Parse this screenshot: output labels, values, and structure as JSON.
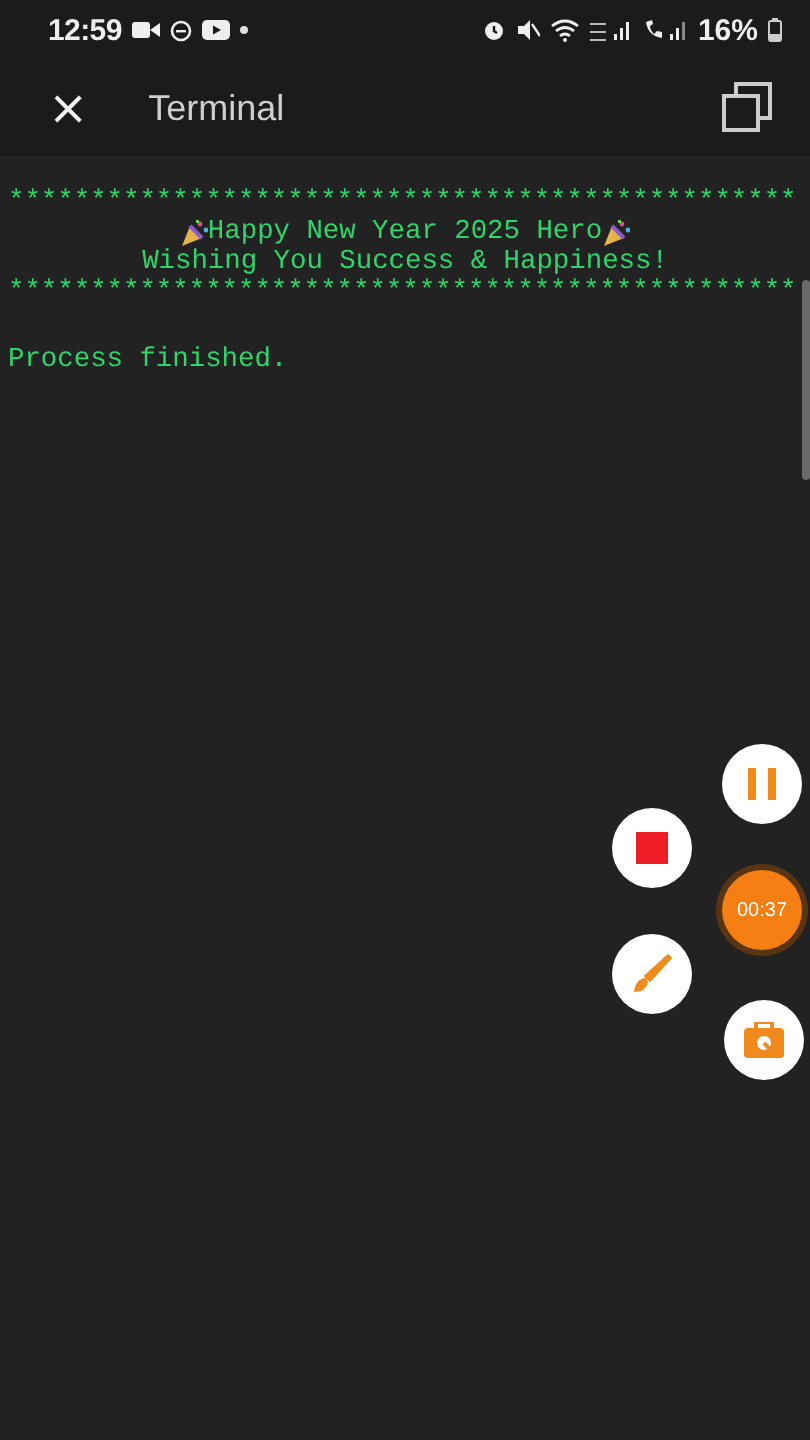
{
  "status_bar": {
    "time": "12:59",
    "battery": "16%"
  },
  "app_bar": {
    "close": "×",
    "title": "Terminal"
  },
  "terminal": {
    "lines": [
      {
        "kind": "rule",
        "text": "************************************************"
      },
      {
        "kind": "banner",
        "text": "Happy New Year 2025 Hero"
      },
      {
        "kind": "center",
        "text": "Wishing You Success & Happiness!"
      },
      {
        "kind": "rule",
        "text": "************************************************"
      },
      {
        "kind": "blank"
      },
      {
        "kind": "plain",
        "text": "Process finished."
      }
    ]
  },
  "recorder": {
    "timer": "00:37"
  }
}
